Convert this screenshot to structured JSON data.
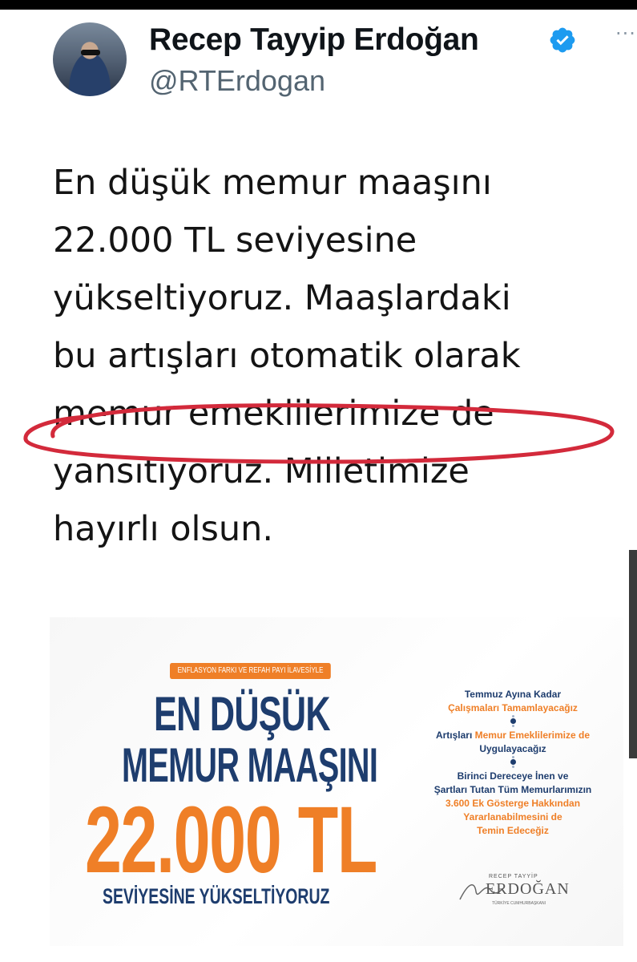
{
  "tweet": {
    "display_name": "Recep Tayyip Erdoğan",
    "handle": "@RTErdogan",
    "more_label": "···",
    "text": "En düşük memur maaşını\n22.000 TL seviyesine\nyükseltiyoruz. Maaşlardaki\nbu artışları otomatik olarak\nmemur emeklilerimize de\nyansıtıyoruz. Milletimize\nhayırlı olsun.",
    "highlight_color": "#d32a3b",
    "verified_color": "#1d9bf0"
  },
  "infographic": {
    "tag": "ENFLASYON FARKI VE REFAH PAYI İLAVESİYLE",
    "headline_line1": "EN DÜŞÜK",
    "headline_line2": "MEMUR MAAŞINI",
    "amount": "22.000 TL",
    "subline": "SEVİYESİNE YÜKSELTİYORUZ",
    "steps": [
      {
        "line1": "Temmuz Ayına Kadar",
        "line2": "Çalışmaları Tamamlayacağız"
      },
      {
        "pre": "Artışları ",
        "highlight": "Memur Emeklilerimize de",
        "line2": "Uygulayacağız"
      },
      {
        "lines": [
          "Birinci Dereceye İnen ve",
          "Şartları Tutan Tüm Memurlarımızın"
        ],
        "highlight_lines": [
          "3.600 Ek Gösterge Hakkından",
          "Yararlanabilmesini de",
          "Temin Edeceğiz"
        ]
      }
    ],
    "signature": {
      "top": "RECEP TAYYİP",
      "name": "ERDOĞAN",
      "bottom": "TÜRKİYE CUMHURBAŞKANI"
    },
    "colors": {
      "navy": "#1e3d6e",
      "orange": "#ef7f27"
    }
  }
}
